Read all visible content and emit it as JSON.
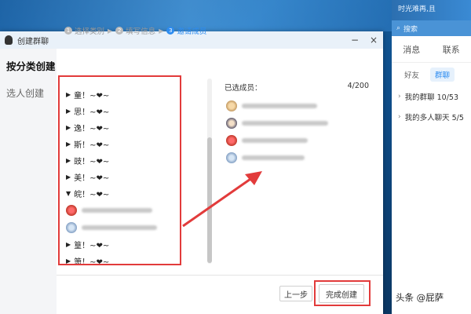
{
  "dialog": {
    "title": "创建群聊",
    "minimize": "−",
    "close": "×"
  },
  "leftnav": {
    "category_create": "按分类创建",
    "pick_create": "选人创建"
  },
  "steps": [
    {
      "num": "1",
      "label": "选择类别",
      "sep": "▶"
    },
    {
      "num": "2",
      "label": "填写信息",
      "sep": "▶"
    },
    {
      "num": "3",
      "label": "邀请成员",
      "sep": ""
    }
  ],
  "groups": [
    {
      "arrow": "▶",
      "label": "童！~❤~"
    },
    {
      "arrow": "▶",
      "label": "思！~❤~"
    },
    {
      "arrow": "▶",
      "label": "逸！~❤~"
    },
    {
      "arrow": "▶",
      "label": "斯！~❤~"
    },
    {
      "arrow": "▶",
      "label": "豉！~❤~"
    },
    {
      "arrow": "▶",
      "label": "美！~❤~"
    },
    {
      "arrow": "▼",
      "label": "皖！~❤~"
    }
  ],
  "groups_after": [
    {
      "arrow": "▶",
      "label": "篁！~❤~"
    },
    {
      "arrow": "▶",
      "label": "箫！~❤~"
    }
  ],
  "selected": {
    "label": "已选成员：",
    "count": "4/200"
  },
  "buttons": {
    "prev": "上一步",
    "finish": "完成创建"
  },
  "rightpanel": {
    "top_text": "时光难再,且",
    "search": "搜索",
    "tab_messages": "消息",
    "tab_contacts": "联系",
    "sub_friends": "好友",
    "sub_groups": "群聊",
    "my_groups": "我的群聊 10/53",
    "my_multichat": "我的多人聊天 5/5"
  },
  "watermark": "头条 @屁萨",
  "colors": {
    "accent": "#2d8cf0",
    "highlight": "#e23b3b"
  }
}
